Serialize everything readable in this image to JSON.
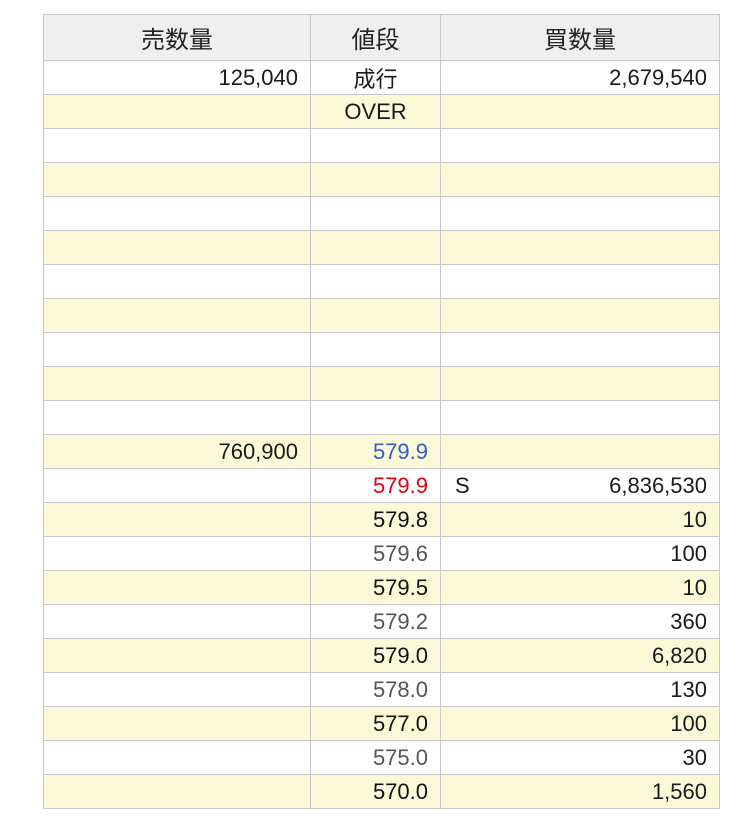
{
  "header": {
    "sell_label": "売数量",
    "price_label": "値段",
    "buy_label": "買数量"
  },
  "market_row": {
    "sell": "125,040",
    "price": "成行",
    "buy": "2,679,540"
  },
  "over_row": {
    "sell": "",
    "price": "OVER",
    "buy": ""
  },
  "empty_rows": [
    {
      "sell": "",
      "price": "",
      "buy": ""
    },
    {
      "sell": "",
      "price": "",
      "buy": ""
    },
    {
      "sell": "",
      "price": "",
      "buy": ""
    },
    {
      "sell": "",
      "price": "",
      "buy": ""
    },
    {
      "sell": "",
      "price": "",
      "buy": ""
    },
    {
      "sell": "",
      "price": "",
      "buy": ""
    },
    {
      "sell": "",
      "price": "",
      "buy": ""
    },
    {
      "sell": "",
      "price": "",
      "buy": ""
    },
    {
      "sell": "",
      "price": "",
      "buy": ""
    }
  ],
  "book_rows": [
    {
      "sell": "760,900",
      "price": "579.9",
      "mark": "",
      "buy": "",
      "price_color": "#2e5fc6"
    },
    {
      "sell": "",
      "price": "579.9",
      "mark": "S",
      "buy": "6,836,530",
      "price_color": "#e60012"
    },
    {
      "sell": "",
      "price": "579.8",
      "mark": "",
      "buy": "10",
      "price_color": "#111111"
    },
    {
      "sell": "",
      "price": "579.6",
      "mark": "",
      "buy": "100",
      "price_color": "#555555"
    },
    {
      "sell": "",
      "price": "579.5",
      "mark": "",
      "buy": "10",
      "price_color": "#111111"
    },
    {
      "sell": "",
      "price": "579.2",
      "mark": "",
      "buy": "360",
      "price_color": "#555555"
    },
    {
      "sell": "",
      "price": "579.0",
      "mark": "",
      "buy": "6,820",
      "price_color": "#111111"
    },
    {
      "sell": "",
      "price": "578.0",
      "mark": "",
      "buy": "130",
      "price_color": "#555555"
    },
    {
      "sell": "",
      "price": "577.0",
      "mark": "",
      "buy": "100",
      "price_color": "#111111"
    },
    {
      "sell": "",
      "price": "575.0",
      "mark": "",
      "buy": "30",
      "price_color": "#555555"
    },
    {
      "sell": "",
      "price": "570.0",
      "mark": "",
      "buy": "1,560",
      "price_color": "#111111"
    }
  ],
  "colors": {
    "row_alt": "#fdf9d8",
    "header_bg": "#efefef",
    "border": "#c8c8c8"
  }
}
